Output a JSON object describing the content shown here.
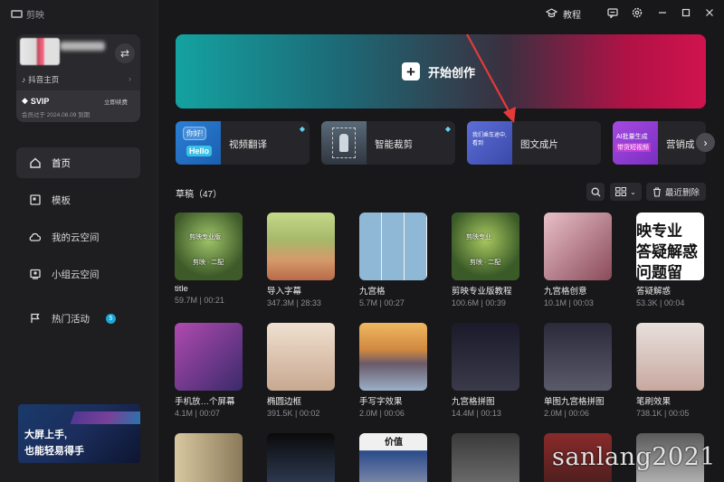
{
  "app": {
    "logo_text": "剪映"
  },
  "profile": {
    "douyin_label": "抖音主页",
    "svip_label": "SVIP",
    "svip_right": "立即续费",
    "svip_expiry": "会员过于 2024.08.09 到期"
  },
  "nav": {
    "items": [
      {
        "label": "首页",
        "icon": "home-icon"
      },
      {
        "label": "模板",
        "icon": "template-icon"
      },
      {
        "label": "我的云空间",
        "icon": "cloud-icon"
      },
      {
        "label": "小组云空间",
        "icon": "group-cloud-icon"
      },
      {
        "label": "热门活动",
        "icon": "flag-icon",
        "badge": "5"
      }
    ]
  },
  "promo": {
    "line1": "大屏上手,",
    "line2": "也能轻易得手"
  },
  "topbar": {
    "tutorial_label": "教程"
  },
  "hero": {
    "label": "开始创作"
  },
  "tools": [
    {
      "label": "视频翻译",
      "thumb_text_1": "你好!",
      "thumb_text_2": "Hello",
      "premium": true
    },
    {
      "label": "智能裁剪",
      "premium": true
    },
    {
      "label": "图文成片",
      "thumb_text_1": "我们乘车途中, 看到",
      "premium": false
    },
    {
      "label": "营销成",
      "thumb_text_1": "AI批量生成",
      "thumb_text_2": "带货短视频",
      "premium": false
    }
  ],
  "drafts": {
    "header": "草稿（47）",
    "delete_label": "最近删除",
    "items": [
      {
        "name": "title",
        "meta": "59.7M | 00:21",
        "overlay": [
          "剪映专业版",
          "剪映 · 二配"
        ]
      },
      {
        "name": "导入字幕",
        "meta": "347.3M | 28:33"
      },
      {
        "name": "九宫格",
        "meta": "5.7M | 00:27"
      },
      {
        "name": "剪映专业版教程",
        "meta": "100.6M | 00:39",
        "overlay": [
          "剪映专业",
          "剪映 · 二配"
        ]
      },
      {
        "name": "九宫格创意",
        "meta": "10.1M | 00:03"
      },
      {
        "name": "答疑解惑",
        "meta": "53.3K | 00:04",
        "overlay": [
          "映专业",
          "答疑解惑",
          "问题留"
        ]
      },
      {
        "name": "手机放…个屏幕",
        "meta": "4.1M | 00:07"
      },
      {
        "name": "椭圆边框",
        "meta": "391.5K | 00:02"
      },
      {
        "name": "手写字效果",
        "meta": "2.0M | 00:06"
      },
      {
        "name": "九宫格拼图",
        "meta": "14.4M | 00:13"
      },
      {
        "name": "单图九宫格拼图",
        "meta": "2.0M | 00:06"
      },
      {
        "name": "笔刷效果",
        "meta": "738.1K | 00:05"
      },
      {
        "name": "",
        "meta": ""
      },
      {
        "name": "",
        "meta": ""
      },
      {
        "name": "",
        "meta": "",
        "overlay": [
          "价值"
        ]
      },
      {
        "name": "",
        "meta": ""
      },
      {
        "name": "",
        "meta": ""
      },
      {
        "name": "",
        "meta": ""
      }
    ]
  },
  "watermark": "sanlang2021",
  "colors": {
    "accent": "#1aa9d6",
    "hero_start": "#14a2a0",
    "hero_end": "#d0134e",
    "arrow": "#e53a3a"
  }
}
